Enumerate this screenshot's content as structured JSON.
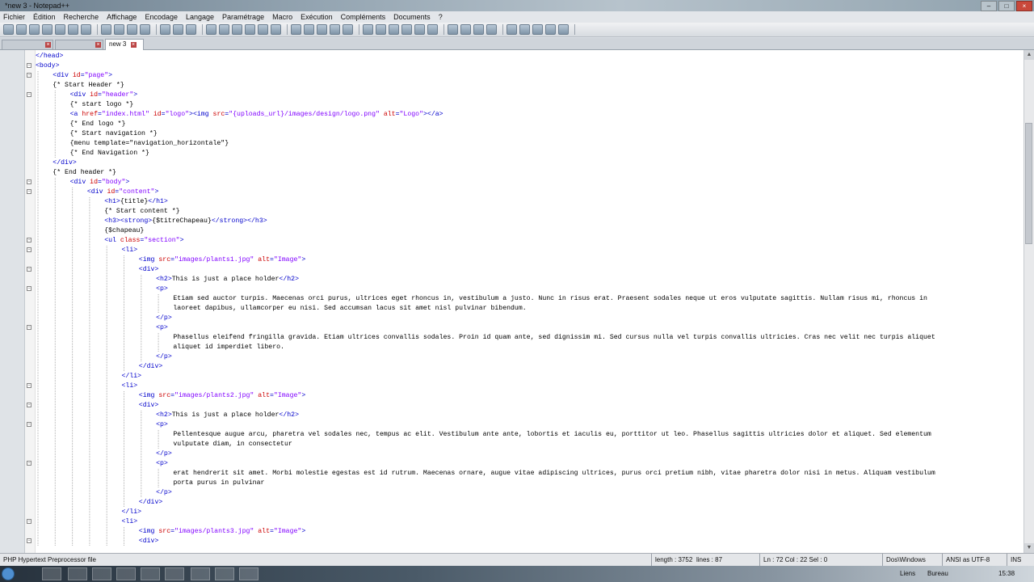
{
  "window": {
    "title": "*new 3 - Notepad++"
  },
  "menu": [
    "Fichier",
    "Édition",
    "Recherche",
    "Affichage",
    "Encodage",
    "Langage",
    "Paramétrage",
    "Macro",
    "Exécution",
    "Compléments",
    "Documents",
    "?"
  ],
  "tabs": [
    {
      "label": "",
      "active": false
    },
    {
      "label": "",
      "active": false
    },
    {
      "label": "new 3",
      "active": true
    }
  ],
  "editor": {
    "lines": [
      {
        "n": "",
        "indent": 0,
        "fold": "",
        "parts": [
          [
            "tag",
            "</head>"
          ]
        ]
      },
      {
        "n": "",
        "indent": 0,
        "fold": "-",
        "parts": [
          [
            "tag",
            "<body>"
          ]
        ]
      },
      {
        "n": "",
        "indent": 1,
        "fold": "-",
        "parts": [
          [
            "tag",
            "<div "
          ],
          [
            "attr",
            "id"
          ],
          [
            "tag",
            "="
          ],
          [
            "val",
            "\"page\""
          ],
          [
            "tag",
            ">"
          ]
        ]
      },
      {
        "n": "",
        "indent": 1,
        "fold": "",
        "parts": [
          [
            "txt",
            "{* Start Header *}"
          ]
        ]
      },
      {
        "n": "",
        "indent": 2,
        "fold": "-",
        "parts": [
          [
            "tag",
            "<div "
          ],
          [
            "attr",
            "id"
          ],
          [
            "tag",
            "="
          ],
          [
            "val",
            "\"header\""
          ],
          [
            "tag",
            ">"
          ]
        ]
      },
      {
        "n": "",
        "indent": 2,
        "fold": "",
        "parts": [
          [
            "txt",
            "{* start logo *}"
          ]
        ]
      },
      {
        "n": "",
        "indent": 2,
        "fold": "",
        "parts": [
          [
            "tag",
            "<a "
          ],
          [
            "attr",
            "href"
          ],
          [
            "tag",
            "="
          ],
          [
            "val",
            "\"index.html\""
          ],
          [
            "tag",
            " "
          ],
          [
            "attr",
            "id"
          ],
          [
            "tag",
            "="
          ],
          [
            "val",
            "\"logo\""
          ],
          [
            "tag",
            "><img "
          ],
          [
            "attr",
            "src"
          ],
          [
            "tag",
            "="
          ],
          [
            "val",
            "\"{uploads_url}/images/design/logo.png\""
          ],
          [
            "tag",
            " "
          ],
          [
            "attr",
            "alt"
          ],
          [
            "tag",
            "="
          ],
          [
            "val",
            "\"Logo\""
          ],
          [
            "tag",
            "></a>"
          ]
        ]
      },
      {
        "n": "",
        "indent": 2,
        "fold": "",
        "parts": [
          [
            "txt",
            "{* End logo *}"
          ]
        ]
      },
      {
        "n": "",
        "indent": 2,
        "fold": "",
        "parts": [
          [
            "txt",
            "{* Start navigation *}"
          ]
        ]
      },
      {
        "n": "",
        "indent": 2,
        "fold": "",
        "parts": [
          [
            "txt",
            "{menu template=\"navigation_horizontale\"}"
          ]
        ]
      },
      {
        "n": "",
        "indent": 2,
        "fold": "",
        "parts": [
          [
            "txt",
            "{* End Navigation *}"
          ]
        ]
      },
      {
        "n": "",
        "indent": 1,
        "fold": "",
        "parts": [
          [
            "tag",
            "</div>"
          ]
        ]
      },
      {
        "n": "",
        "indent": 1,
        "fold": "",
        "parts": [
          [
            "txt",
            "{* End header *}"
          ]
        ]
      },
      {
        "n": "",
        "indent": 2,
        "fold": "-",
        "parts": [
          [
            "tag",
            "<div "
          ],
          [
            "attr",
            "id"
          ],
          [
            "tag",
            "="
          ],
          [
            "val",
            "\"body\""
          ],
          [
            "tag",
            ">"
          ]
        ]
      },
      {
        "n": "",
        "indent": 3,
        "fold": "-",
        "parts": [
          [
            "tag",
            "<div "
          ],
          [
            "attr",
            "id"
          ],
          [
            "tag",
            "="
          ],
          [
            "val",
            "\"content\""
          ],
          [
            "tag",
            ">"
          ]
        ]
      },
      {
        "n": "",
        "indent": 4,
        "fold": "",
        "parts": [
          [
            "tag",
            "<h1>"
          ],
          [
            "txt",
            "{title}"
          ],
          [
            "tag",
            "</h1>"
          ]
        ]
      },
      {
        "n": "",
        "indent": 4,
        "fold": "",
        "parts": [
          [
            "txt",
            "{* Start content *}"
          ]
        ]
      },
      {
        "n": "",
        "indent": 4,
        "fold": "",
        "parts": [
          [
            "tag",
            "<h3><strong>"
          ],
          [
            "txt",
            "{$titreChapeau}"
          ],
          [
            "tag",
            "</strong></h3>"
          ]
        ]
      },
      {
        "n": "",
        "indent": 4,
        "fold": "",
        "parts": [
          [
            "txt",
            "{$chapeau}"
          ]
        ]
      },
      {
        "n": "",
        "indent": 4,
        "fold": "-",
        "parts": [
          [
            "tag",
            "<ul "
          ],
          [
            "attr",
            "class"
          ],
          [
            "tag",
            "="
          ],
          [
            "val",
            "\"section\""
          ],
          [
            "tag",
            ">"
          ]
        ]
      },
      {
        "n": "",
        "indent": 5,
        "fold": "-",
        "parts": [
          [
            "tag",
            "<li>"
          ]
        ]
      },
      {
        "n": "",
        "indent": 6,
        "fold": "",
        "parts": [
          [
            "tag",
            "<img "
          ],
          [
            "attr",
            "src"
          ],
          [
            "tag",
            "="
          ],
          [
            "val",
            "\"images/plants1.jpg\""
          ],
          [
            "tag",
            " "
          ],
          [
            "attr",
            "alt"
          ],
          [
            "tag",
            "="
          ],
          [
            "val",
            "\"Image\""
          ],
          [
            "tag",
            ">"
          ]
        ]
      },
      {
        "n": "",
        "indent": 6,
        "fold": "-",
        "parts": [
          [
            "tag",
            "<div>"
          ]
        ]
      },
      {
        "n": "",
        "indent": 7,
        "fold": "",
        "parts": [
          [
            "tag",
            "<h2>"
          ],
          [
            "txt",
            "This is just a place holder"
          ],
          [
            "tag",
            "</h2>"
          ]
        ]
      },
      {
        "n": "",
        "indent": 7,
        "fold": "-",
        "parts": [
          [
            "tag",
            "<p>"
          ]
        ]
      },
      {
        "n": "",
        "indent": 8,
        "fold": "",
        "parts": [
          [
            "txt",
            "Etiam sed auctor turpis. Maecenas orci purus, ultrices eget rhoncus in, vestibulum a justo. Nunc in risus erat. Praesent sodales neque ut eros vulputate sagittis. Nullam risus mi, rhoncus in"
          ]
        ]
      },
      {
        "n": "",
        "indent": 8,
        "fold": "",
        "parts": [
          [
            "txt",
            "laoreet dapibus, ullamcorper eu nisi. Sed accumsan lacus sit amet nisl pulvinar bibendum."
          ]
        ]
      },
      {
        "n": "",
        "indent": 7,
        "fold": "",
        "parts": [
          [
            "tag",
            "</p>"
          ]
        ]
      },
      {
        "n": "",
        "indent": 7,
        "fold": "-",
        "parts": [
          [
            "tag",
            "<p>"
          ]
        ]
      },
      {
        "n": "",
        "indent": 8,
        "fold": "",
        "parts": [
          [
            "txt",
            "Phasellus eleifend fringilla gravida. Etiam ultrices convallis sodales. Proin id quam ante, sed dignissim mi. Sed cursus nulla vel turpis convallis ultricies. Cras nec velit nec turpis aliquet"
          ]
        ]
      },
      {
        "n": "",
        "indent": 8,
        "fold": "",
        "parts": [
          [
            "txt",
            "aliquet id imperdiet libero."
          ]
        ]
      },
      {
        "n": "",
        "indent": 7,
        "fold": "",
        "parts": [
          [
            "tag",
            "</p>"
          ]
        ]
      },
      {
        "n": "",
        "indent": 6,
        "fold": "",
        "parts": [
          [
            "tag",
            "</div>"
          ]
        ]
      },
      {
        "n": "",
        "indent": 5,
        "fold": "",
        "parts": [
          [
            "tag",
            "</li>"
          ]
        ]
      },
      {
        "n": "",
        "indent": 5,
        "fold": "-",
        "parts": [
          [
            "tag",
            "<li>"
          ]
        ]
      },
      {
        "n": "",
        "indent": 6,
        "fold": "",
        "parts": [
          [
            "tag",
            "<img "
          ],
          [
            "attr",
            "src"
          ],
          [
            "tag",
            "="
          ],
          [
            "val",
            "\"images/plants2.jpg\""
          ],
          [
            "tag",
            " "
          ],
          [
            "attr",
            "alt"
          ],
          [
            "tag",
            "="
          ],
          [
            "val",
            "\"Image\""
          ],
          [
            "tag",
            ">"
          ]
        ]
      },
      {
        "n": "",
        "indent": 6,
        "fold": "-",
        "parts": [
          [
            "tag",
            "<div>"
          ]
        ]
      },
      {
        "n": "",
        "indent": 7,
        "fold": "",
        "parts": [
          [
            "tag",
            "<h2>"
          ],
          [
            "txt",
            "This is just a place holder"
          ],
          [
            "tag",
            "</h2>"
          ]
        ]
      },
      {
        "n": "",
        "indent": 7,
        "fold": "-",
        "parts": [
          [
            "tag",
            "<p>"
          ]
        ]
      },
      {
        "n": "",
        "indent": 8,
        "fold": "",
        "parts": [
          [
            "txt",
            "Pellentesque augue arcu, pharetra vel sodales nec, tempus ac elit. Vestibulum ante ante, lobortis et iaculis eu, porttitor ut leo. Phasellus sagittis ultricies dolor et aliquet. Sed elementum"
          ]
        ]
      },
      {
        "n": "",
        "indent": 8,
        "fold": "",
        "parts": [
          [
            "txt",
            "vulputate diam, in consectetur"
          ]
        ]
      },
      {
        "n": "",
        "indent": 7,
        "fold": "",
        "parts": [
          [
            "tag",
            "</p>"
          ]
        ]
      },
      {
        "n": "",
        "indent": 7,
        "fold": "-",
        "parts": [
          [
            "tag",
            "<p>"
          ]
        ]
      },
      {
        "n": "",
        "indent": 8,
        "fold": "",
        "parts": [
          [
            "txt",
            "erat hendrerit sit amet. Morbi molestie egestas est id rutrum. Maecenas ornare, augue vitae adipiscing ultrices, purus orci pretium nibh, vitae pharetra dolor nisi in metus. Aliquam vestibulum"
          ]
        ]
      },
      {
        "n": "",
        "indent": 8,
        "fold": "",
        "parts": [
          [
            "txt",
            "porta purus in pulvinar"
          ]
        ]
      },
      {
        "n": "",
        "indent": 7,
        "fold": "",
        "parts": [
          [
            "tag",
            "</p>"
          ]
        ]
      },
      {
        "n": "",
        "indent": 6,
        "fold": "",
        "parts": [
          [
            "tag",
            "</div>"
          ]
        ]
      },
      {
        "n": "",
        "indent": 5,
        "fold": "",
        "parts": [
          [
            "tag",
            "</li>"
          ]
        ]
      },
      {
        "n": "",
        "indent": 5,
        "fold": "-",
        "parts": [
          [
            "tag",
            "<li>"
          ]
        ]
      },
      {
        "n": "",
        "indent": 6,
        "fold": "",
        "parts": [
          [
            "tag",
            "<img "
          ],
          [
            "attr",
            "src"
          ],
          [
            "tag",
            "="
          ],
          [
            "val",
            "\"images/plants3.jpg\""
          ],
          [
            "tag",
            " "
          ],
          [
            "attr",
            "alt"
          ],
          [
            "tag",
            "="
          ],
          [
            "val",
            "\"Image\""
          ],
          [
            "tag",
            ">"
          ]
        ]
      },
      {
        "n": "",
        "indent": 6,
        "fold": "-",
        "parts": [
          [
            "tag",
            "<div>"
          ]
        ]
      }
    ]
  },
  "status": {
    "file_type": "PHP Hypertext Preprocessor file",
    "length": "length : 3752",
    "lines": "lines : 87",
    "position": "Ln : 72   Col : 22   Sel : 0",
    "eol": "Dos\\Windows",
    "encoding": "ANSI as UTF-8",
    "mode": "INS"
  },
  "taskbar": {
    "links": "Liens",
    "desktop": "Bureau",
    "clock": "15:38"
  },
  "colors": {
    "tag": "#0000cc",
    "attribute": "#cc0000",
    "value": "#8000ff"
  }
}
